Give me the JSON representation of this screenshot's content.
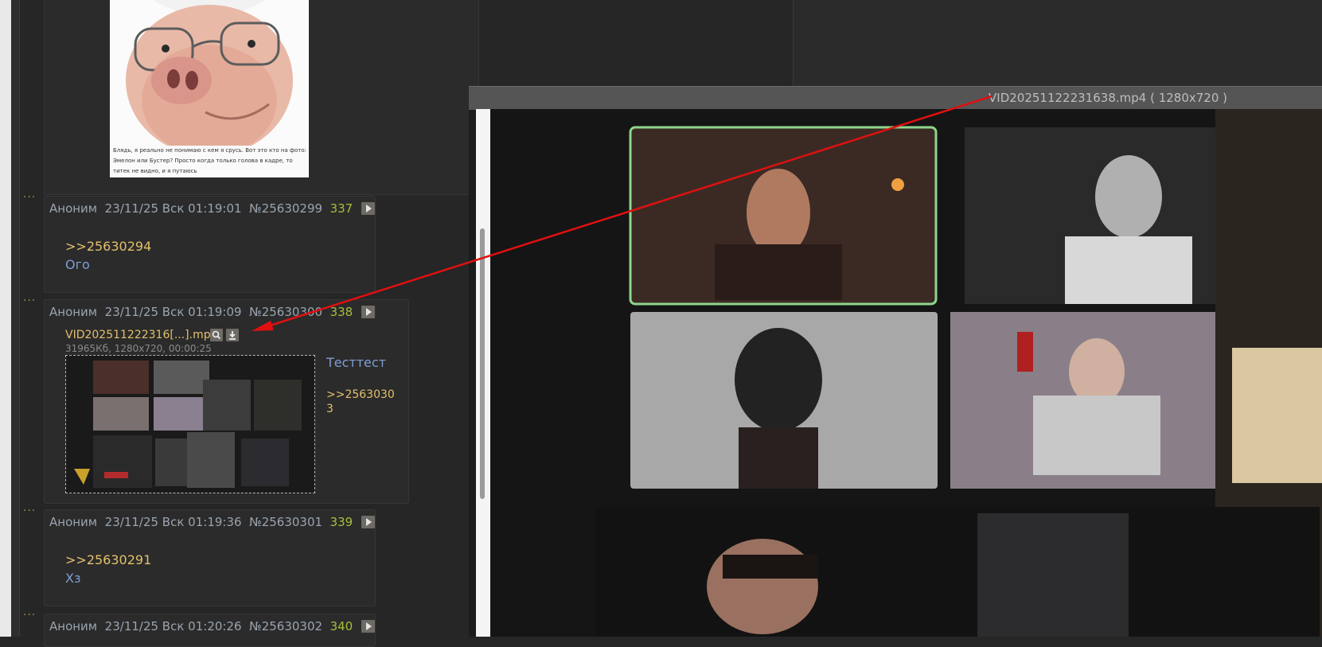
{
  "pig_post": {
    "caption": "Блядь, я реально не понимаю с кем я срусь. Вот это кто на фото: Эмелон или Бустер? Просто когда только голова в кадре, то титек не видно, и я путаюсь"
  },
  "posts": [
    {
      "author": "Аноним",
      "datetime": "23/11/25 Вск 01:19:01",
      "post_no": "№25630299",
      "index": "337",
      "reply": ">>25630294",
      "text": "Ого"
    },
    {
      "author": "Аноним",
      "datetime": "23/11/25 Вск 01:19:09",
      "post_no": "№25630300",
      "index": "338",
      "file_name": "VID202511222316[...].mp4",
      "file_meta": "31965Кб, 1280x720, 00:00:25",
      "text": "Тесттест",
      "reply_line1": ">>2563030",
      "reply_line2": "3"
    },
    {
      "author": "Аноним",
      "datetime": "23/11/25 Вск 01:19:36",
      "post_no": "№25630301",
      "index": "339",
      "reply": ">>25630291",
      "text": "Хз"
    },
    {
      "author": "Аноним",
      "datetime": "23/11/25 Вск 01:20:26",
      "post_no": "№25630302",
      "index": "340"
    }
  ],
  "dots": "···",
  "viewer": {
    "title": "VID20251122231638.mp4 ( 1280x720 )"
  },
  "icons": {
    "play": "play-icon",
    "search": "magnifier-icon",
    "download": "download-icon"
  },
  "colors": {
    "background": "#262626",
    "post_bg": "#2b2b2b",
    "reply_link": "#e3c06b",
    "message_text": "#7f9ed4",
    "post_index": "#a4bf3b",
    "arrow": "#e01010"
  }
}
